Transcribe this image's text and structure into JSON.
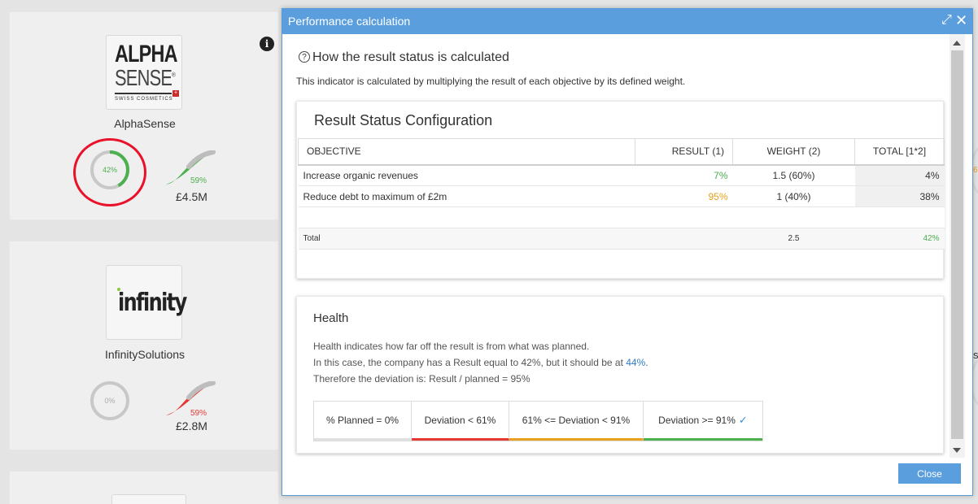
{
  "background": {
    "cards": [
      {
        "name": "AlphaSense",
        "logo": {
          "line1": "ALPHA",
          "line2": "SENSE",
          "reg": "®",
          "sub": "SWISS COSMETICS"
        },
        "ring_percent": "42%",
        "ring_value": 0.42,
        "spark_percent": "59%",
        "amount": "£4.5M"
      },
      {
        "name": "InfinitySolutions",
        "logo": {
          "word": "infinity"
        },
        "ring_percent": "0%",
        "ring_value": 0,
        "spark_percent": "59%",
        "amount": "£2.8M"
      }
    ],
    "info_icon": "i",
    "edge_fragments": [
      "6",
      "s"
    ]
  },
  "modal": {
    "title": "Performance calculation",
    "icons": {
      "expand": "expand-icon",
      "close": "close-icon"
    },
    "heading": "How the result status is calculated",
    "heading_icon": "?",
    "description": "This indicator is calculated by multiplying the result of each objective by its defined weight.",
    "result_config": {
      "title": "Result Status Configuration",
      "columns": [
        "OBJECTIVE",
        "RESULT (1)",
        "WEIGHT (2)",
        "TOTAL [1*2]"
      ],
      "rows": [
        {
          "objective": "Increase organic revenues",
          "result": "7%",
          "weight": "1.5 (60%)",
          "total": "4%"
        },
        {
          "objective": "Reduce debt to maximum of £2m",
          "result": "95%",
          "weight": "1 (40%)",
          "total": "38%"
        }
      ],
      "total_row": {
        "label": "Total",
        "weight": "2.5",
        "total": "42%"
      }
    },
    "health": {
      "title": "Health",
      "line1": "Health indicates how far off the result is from what was planned.",
      "line2_prefix": "In this case, the company has a Result equal to 42%, but it should be at ",
      "line2_value": "44%",
      "line2_suffix": ".",
      "line3": "Therefore the deviation is: Result / planned = 95%",
      "legend": [
        {
          "label": "% Planned = 0%",
          "color": "#e0e0e0"
        },
        {
          "label": "Deviation < 61%",
          "color": "#e53935"
        },
        {
          "label": "61% <= Deviation < 91%",
          "color": "#e8a020"
        },
        {
          "label": "Deviation >= 91%",
          "color": "#4caf50",
          "check": "✓"
        }
      ]
    },
    "close_label": "Close"
  },
  "colors": {
    "header": "#5b9edd",
    "good": "#4caf50",
    "warn": "#e8a020",
    "bad": "#e53935",
    "link": "#2e7bc4"
  }
}
